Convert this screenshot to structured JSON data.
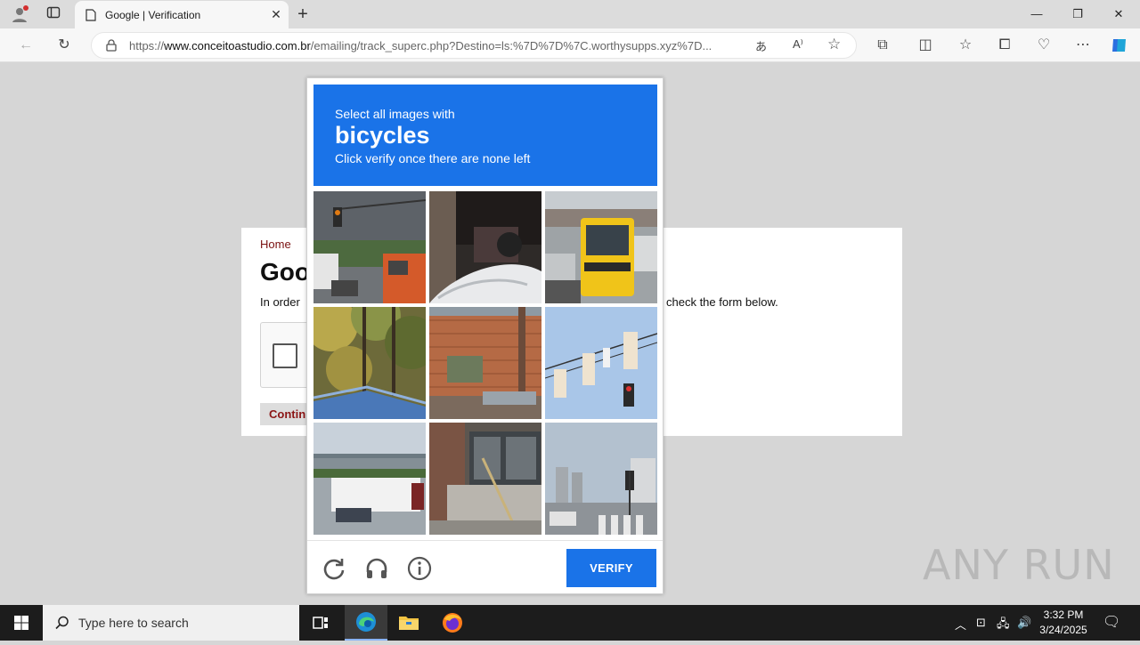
{
  "browser": {
    "tab_title": "Google | Verification",
    "url_prefix": "https://",
    "url_domain": "www.conceitoastudio.com.br",
    "url_path": "/emailing/track_superc.php?Destino=ls:%7D%7D%7C.worthysupps.xyz%7D..."
  },
  "page": {
    "breadcrumb": "Home",
    "heading": "Goo",
    "instruction_start": "In order",
    "instruction_end": "check the form below.",
    "continue_label": "Contin"
  },
  "challenge": {
    "line1": "Select all images with",
    "target": "bicycles",
    "line3": "Click verify once there are none left",
    "verify_label": "VERIFY",
    "tiles": [
      "traffic-light-truck",
      "motorbike-garage",
      "bus-street",
      "trees-railing",
      "brick-building",
      "traffic-lights-wires",
      "overpass-truck",
      "building-entrance",
      "city-crosswalk"
    ]
  },
  "watermark": "ANY RUN",
  "taskbar": {
    "search_placeholder": "Type here to search",
    "time": "3:32 PM",
    "date": "3/24/2025"
  },
  "colors": {
    "accent": "#1a73e8",
    "link": "#7a1010"
  }
}
